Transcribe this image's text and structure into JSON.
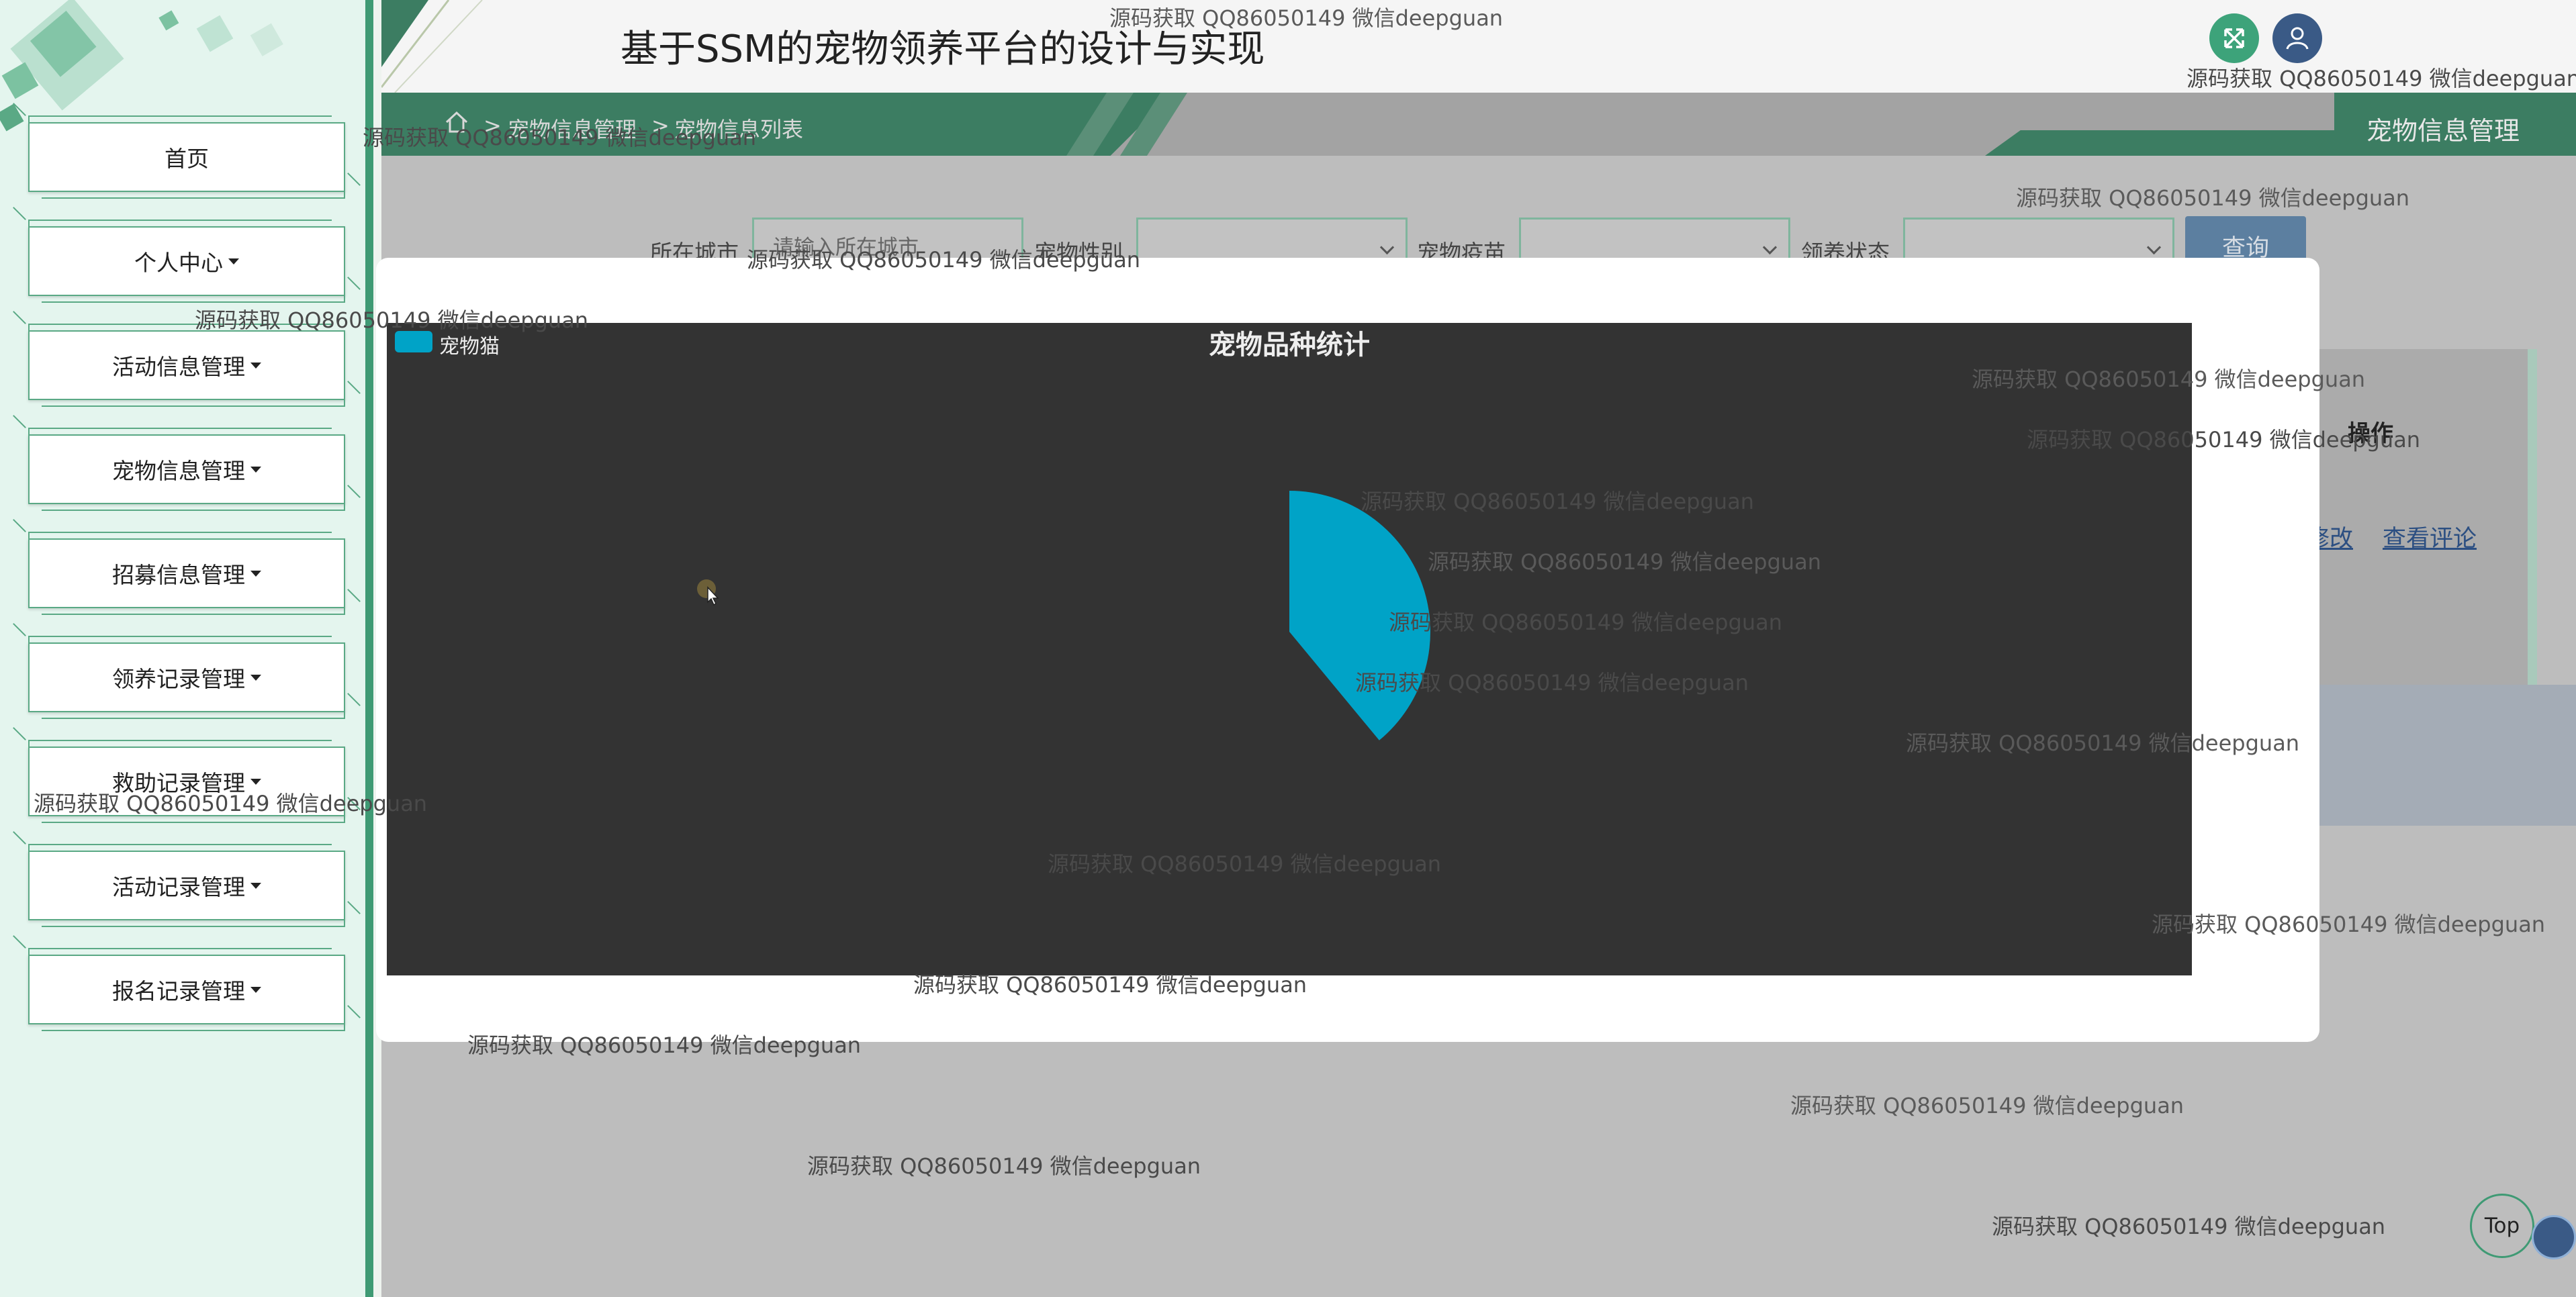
{
  "app": {
    "title": "基于SSM的宠物领养平台的设计与实现"
  },
  "sidebar": {
    "items": [
      {
        "label": "首页",
        "has_caret": false
      },
      {
        "label": "个人中心",
        "has_caret": true
      },
      {
        "label": "活动信息管理",
        "has_caret": true
      },
      {
        "label": "宠物信息管理",
        "has_caret": true
      },
      {
        "label": "招募信息管理",
        "has_caret": true
      },
      {
        "label": "领养记录管理",
        "has_caret": true
      },
      {
        "label": "救助记录管理",
        "has_caret": true
      },
      {
        "label": "活动记录管理",
        "has_caret": true
      },
      {
        "label": "报名记录管理",
        "has_caret": true
      }
    ]
  },
  "breadcrumb": {
    "sep": ">",
    "item1": "宠物信息管理",
    "item2": "宠物信息列表"
  },
  "page_heading": "宠物信息管理",
  "filters": {
    "city_label": "所在城市",
    "city_placeholder": "请输入所在城市",
    "gender_label": "宠物性别",
    "vaccine_label": "宠物疫苗",
    "status_label": "领养状态",
    "search_label": "查询"
  },
  "table": {
    "op_header": "操作",
    "edit_link": "修改",
    "comments_link": "查看评论"
  },
  "scroll_top": {
    "label": "Top"
  },
  "watermark": "源码获取 QQ86050149 微信deepguan",
  "chart_data": {
    "type": "pie",
    "title": "宠物品种统计",
    "legend_position": "top-left",
    "series": [
      {
        "name": "宠物猫",
        "color": "#00a3c7",
        "value": 1
      }
    ],
    "background": "#333333",
    "accent": "#3f9a74"
  }
}
